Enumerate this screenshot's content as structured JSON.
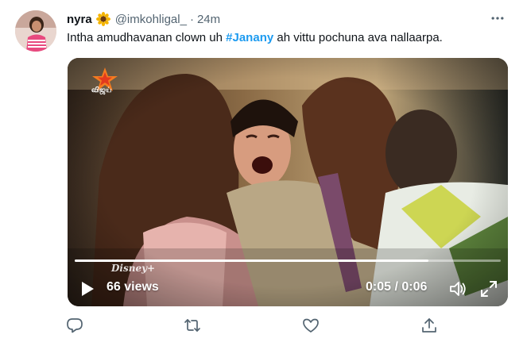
{
  "tweet": {
    "author_name": "nyra",
    "emoji_icon": "sunflower-icon",
    "handle": "@imkohligal_",
    "separator": "·",
    "time": "24m",
    "text_before": "Intha amudhavanan clown uh ",
    "hashtag": "#Janany",
    "text_after": " ah vittu pochuna ava nallaarpa."
  },
  "video": {
    "channel_logo_text": "விஜய்",
    "watermark_text": "Disney+",
    "views": "66 views",
    "timecode": "0:05 / 0:06",
    "progress": 0.83
  },
  "actions": {
    "reply_icon": "reply-icon",
    "retweet_icon": "retweet-icon",
    "like_icon": "like-icon",
    "share_icon": "share-icon"
  },
  "colors": {
    "hashtag": "#1d9bf0",
    "secondary_text": "#536471",
    "action_icon": "#536471"
  }
}
